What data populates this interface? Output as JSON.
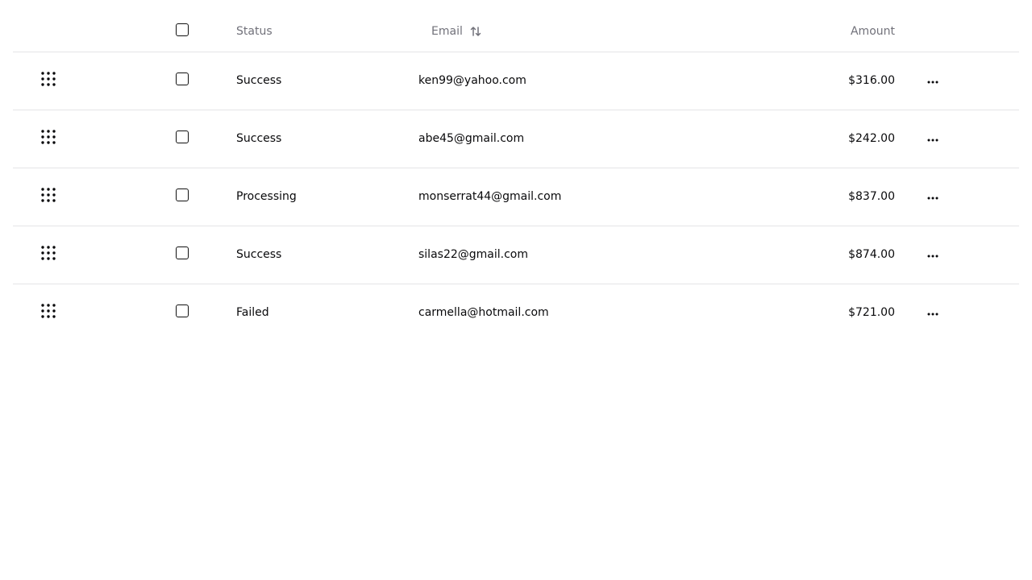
{
  "table": {
    "headers": {
      "status": "Status",
      "email": "Email",
      "amount": "Amount"
    },
    "sort_icon": "arrow-up-down-icon",
    "row_icons": {
      "drag": "grip-icon",
      "actions": "more-horizontal-icon"
    },
    "rows": [
      {
        "status": "Success",
        "email": "ken99@yahoo.com",
        "amount": "$316.00"
      },
      {
        "status": "Success",
        "email": "abe45@gmail.com",
        "amount": "$242.00"
      },
      {
        "status": "Processing",
        "email": "monserrat44@gmail.com",
        "amount": "$837.00"
      },
      {
        "status": "Success",
        "email": "silas22@gmail.com",
        "amount": "$874.00"
      },
      {
        "status": "Failed",
        "email": "carmella@hotmail.com",
        "amount": "$721.00"
      }
    ]
  }
}
